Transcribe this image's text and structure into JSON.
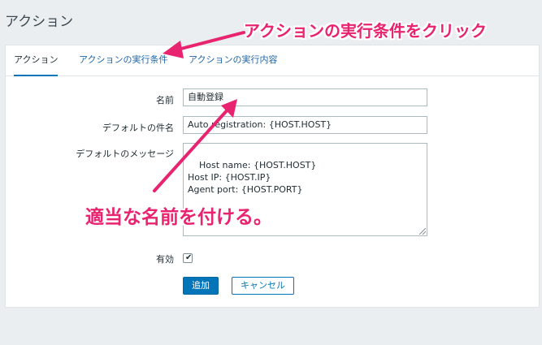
{
  "header": {
    "title": "アクション"
  },
  "tabs": [
    {
      "label": "アクション",
      "active": true
    },
    {
      "label": "アクションの実行条件",
      "active": false
    },
    {
      "label": "アクションの実行内容",
      "active": false
    }
  ],
  "form": {
    "name_label": "名前",
    "name_value": "自動登録",
    "subject_label": "デフォルトの件名",
    "subject_value": "Auto registration: {HOST.HOST}",
    "message_label": "デフォルトのメッセージ",
    "message_value": "Host name: {HOST.HOST}\nHost IP: {HOST.IP}\nAgent port: {HOST.PORT}",
    "enabled_label": "有効",
    "enabled_checked": true,
    "add_button": "追加",
    "cancel_button": "キャンセル"
  },
  "annotations": {
    "top_callout": "アクションの実行条件をクリック",
    "middle_callout": "適当な名前を付ける。"
  },
  "colors": {
    "accent": "#0275b8",
    "annotation": "#e8236f",
    "background": "#ebeef0"
  }
}
